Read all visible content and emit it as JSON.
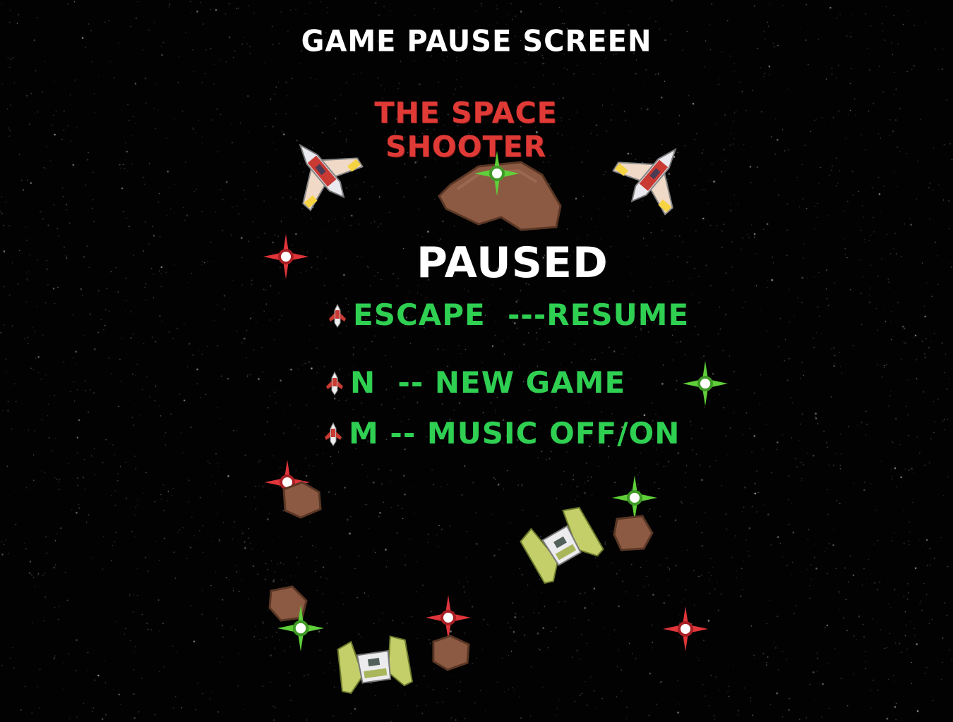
{
  "screen_title": "Game Pause Screen",
  "game_title": "The Space Shooter",
  "status": "Paused",
  "menu": [
    {
      "key": "Escape",
      "separator": "  ---",
      "action": "Resume"
    },
    {
      "key": "N",
      "separator": "  -- ",
      "action": "New Game"
    },
    {
      "key": "M",
      "separator": " -- ",
      "action": "Music Off/On"
    }
  ],
  "colors": {
    "background": "#020202",
    "screen_title": "#ffffff",
    "game_title": "#e03a36",
    "paused": "#ffffff",
    "menu_text": "#2fcf52"
  },
  "icons": {
    "menu_bullet": "ship-bullet-icon",
    "enemy_red": "red-fighter-ship-icon",
    "enemy_green": "green-fighter-ship-icon",
    "asteroid": "asteroid-icon",
    "red_laser": "red-star-laser-icon",
    "green_laser": "green-star-laser-icon"
  }
}
